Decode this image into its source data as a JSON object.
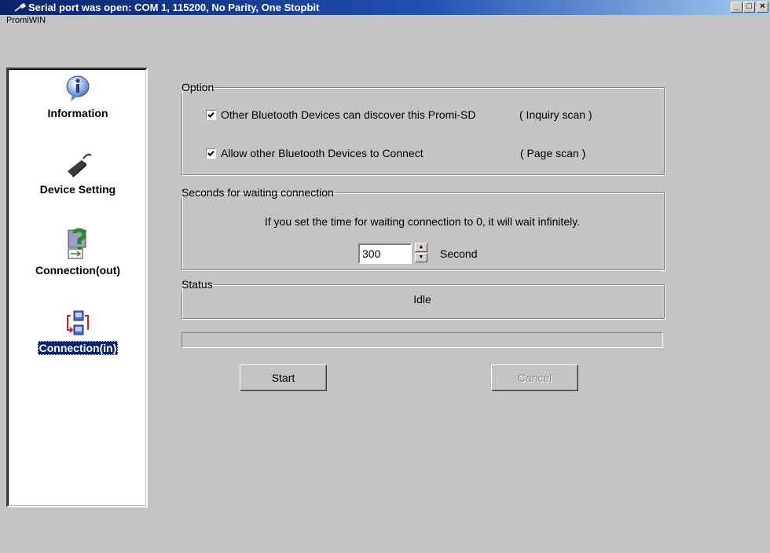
{
  "window": {
    "title": "Serial port was open: COM 1, 115200, No Parity, One Stopbit",
    "app_name": "PromiWIN",
    "controls": {
      "minimize": "_",
      "maximize": "□",
      "close": "×"
    }
  },
  "sidebar": {
    "items": [
      {
        "label": "Information",
        "icon": "info-icon",
        "selected": false
      },
      {
        "label": "Device Setting",
        "icon": "device-icon",
        "selected": false
      },
      {
        "label": "Connection(out)",
        "icon": "connection-out-icon",
        "selected": false
      },
      {
        "label": "Connection(in)",
        "icon": "connection-in-icon",
        "selected": true
      }
    ]
  },
  "option_group": {
    "legend": "Option",
    "inquiry": {
      "checked": true,
      "label": "Other Bluetooth Devices can discover this Promi-SD",
      "hint": "( Inquiry scan )"
    },
    "page": {
      "checked": true,
      "label": "Allow other Bluetooth Devices to Connect",
      "hint": "( Page scan )"
    }
  },
  "waiting_group": {
    "legend": "Seconds for waiting connection",
    "description": "If you set the time for waiting connection to 0, it will wait infinitely.",
    "value": "300",
    "unit": "Second"
  },
  "status_group": {
    "legend": "Status",
    "value": "Idle"
  },
  "progress": 0,
  "buttons": {
    "start": "Start",
    "cancel": "Cancel"
  },
  "colors": {
    "title_bar": "#0a246a",
    "background": "#c6c3c6",
    "selected_item": "#0a246a"
  }
}
